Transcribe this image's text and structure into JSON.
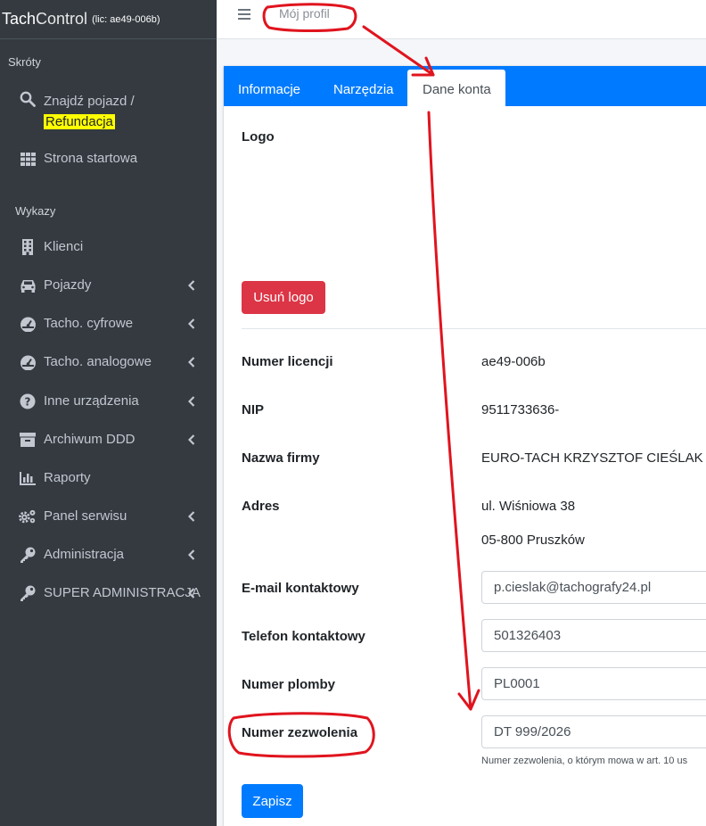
{
  "brand": {
    "name_bold": "Tach",
    "name_light": "Control",
    "license": "(lic: ae49-006b)"
  },
  "sidebar": {
    "header_shortcuts": "Skróty",
    "find_vehicle": "Znajdź pojazd /",
    "refund": "Refundacja",
    "home": "Strona startowa",
    "header_lists": "Wykazy",
    "items": [
      {
        "label": "Klienci",
        "icon": "building-icon",
        "chevron": false
      },
      {
        "label": "Pojazdy",
        "icon": "car-icon",
        "chevron": true
      },
      {
        "label": "Tacho. cyfrowe",
        "icon": "gauge-icon",
        "chevron": true
      },
      {
        "label": "Tacho. analogowe",
        "icon": "gauge-icon",
        "chevron": true
      },
      {
        "label": "Inne urządzenia",
        "icon": "question-icon",
        "chevron": true
      },
      {
        "label": "Archiwum DDD",
        "icon": "archive-icon",
        "chevron": true
      },
      {
        "label": "Raporty",
        "icon": "chart-icon",
        "chevron": false
      },
      {
        "label": "Panel serwisu",
        "icon": "cogs-icon",
        "chevron": true
      },
      {
        "label": "Administracja",
        "icon": "key-icon",
        "chevron": true
      },
      {
        "label": "SUPER ADMINISTRACJA",
        "icon": "key-icon",
        "chevron": true
      }
    ]
  },
  "topbar": {
    "breadcrumb": "Mój profil"
  },
  "tabs": {
    "info": "Informacje",
    "tools": "Narzędzia",
    "account": "Dane konta"
  },
  "account": {
    "logo_label": "Logo",
    "delete_logo": "Usuń logo",
    "license_label": "Numer licencji",
    "license_value": "ae49-006b",
    "nip_label": "NIP",
    "nip_value": "9511733636-",
    "company_label": "Nazwa firmy",
    "company_value": "EURO-TACH KRZYSZTOF CIEŚLAK",
    "address_label": "Adres",
    "address_line1": "ul. Wiśniowa 38",
    "address_line2": "05-800 Pruszków",
    "email_label": "E-mail kontaktowy",
    "email_value": "p.cieslak@tachografy24.pl",
    "phone_label": "Telefon kontaktowy",
    "phone_value": "501326403",
    "seal_label": "Numer plomby",
    "seal_value": "PL0001",
    "permit_label": "Numer zezwolenia",
    "permit_value": "DT 999/2026",
    "permit_help": "Numer zezwolenia, o którym mowa w art. 10 us",
    "save": "Zapisz"
  },
  "colors": {
    "sidebar": "#343a40",
    "primary": "#007bff",
    "danger": "#dc3545",
    "annotation": "#e0141e",
    "highlight": "#ffff00"
  }
}
